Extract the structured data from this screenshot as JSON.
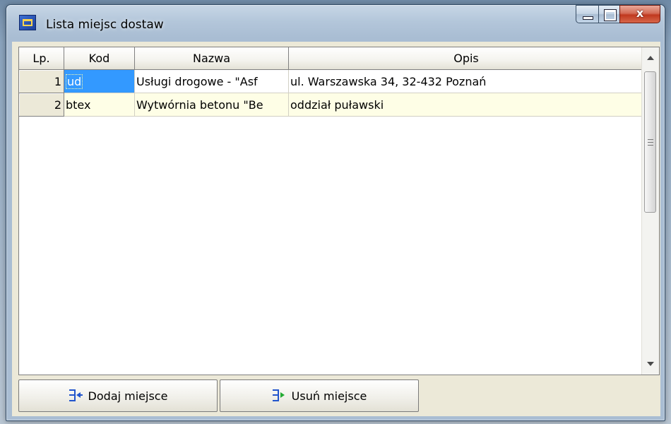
{
  "window": {
    "title": "Lista miejsc dostaw",
    "close_glyph": "x"
  },
  "table": {
    "columns": [
      "Lp.",
      "Kod",
      "Nazwa",
      "Opis"
    ],
    "rows": [
      {
        "lp": "1",
        "kod": "ud",
        "nazwa": "Usługi drogowe - \"Asf",
        "opis": "ul. Warszawska 34, 32-432 Poznań"
      },
      {
        "lp": "2",
        "kod": "btex",
        "nazwa": "Wytwórnia betonu \"Be",
        "opis": "oddział puławski"
      }
    ]
  },
  "buttons": {
    "add_label": "Dodaj miejsce",
    "remove_label": "Usuń miejsce"
  },
  "icons": {
    "app": "delivery-list-icon",
    "add": "add-place-icon",
    "remove": "remove-place-icon"
  },
  "colors": {
    "selection": "#3399ff",
    "alt_row": "#fefee6",
    "close_button": "#c0391f"
  }
}
